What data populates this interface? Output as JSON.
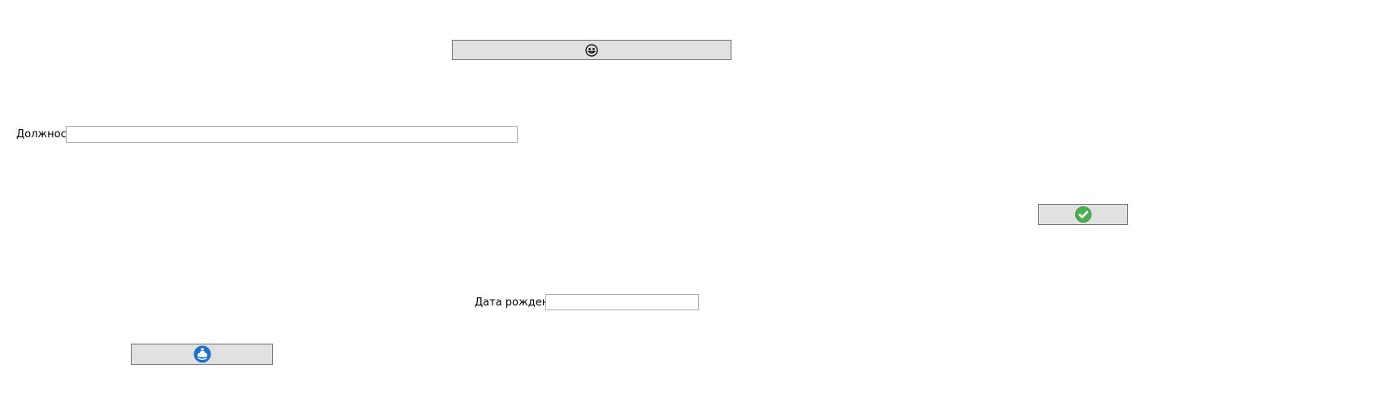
{
  "buttons": {
    "top": {
      "icon": "smiley-face-icon"
    },
    "confirm": {
      "icon": "green-checkmark-icon",
      "icon_color": "#4caf50"
    },
    "bottom": {
      "icon": "blue-cloud-badge-icon",
      "icon_color": "#1e6fc8"
    }
  },
  "form": {
    "position_label": "Должность",
    "position_value": "",
    "birthdate_label": "Дата рождения",
    "birthdate_value": ""
  },
  "colors": {
    "button_face": "#e1e1e1",
    "button_border": "#707070",
    "field_border": "#abadb3"
  }
}
